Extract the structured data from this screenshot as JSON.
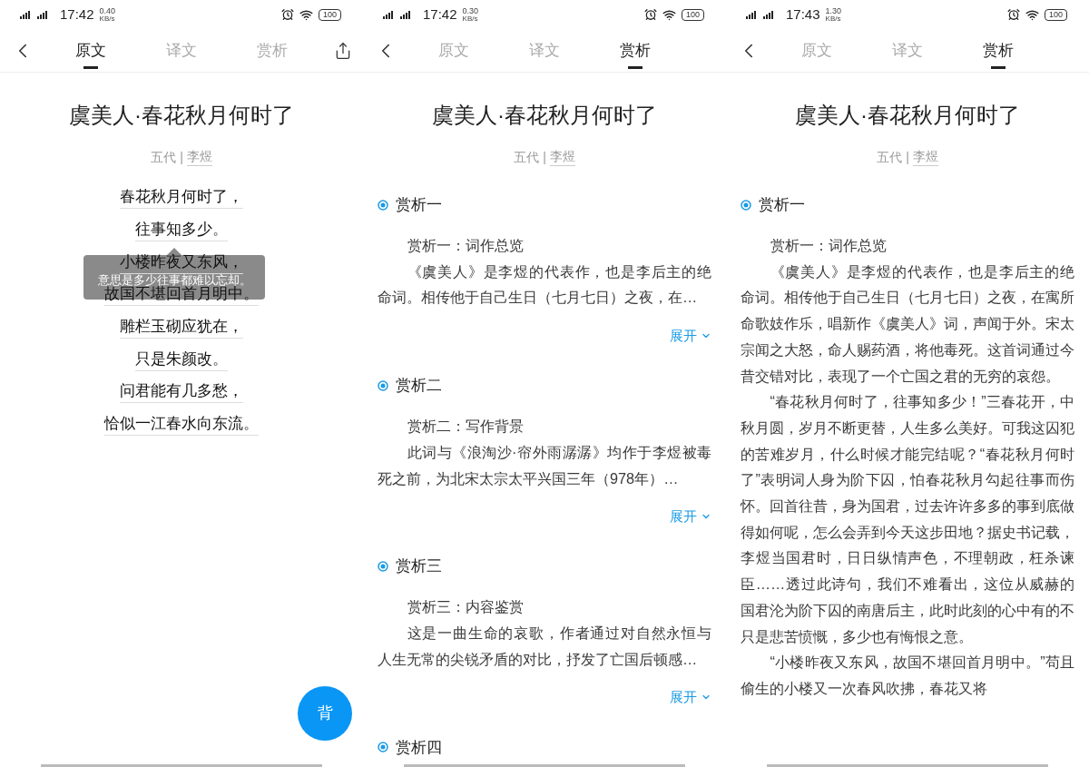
{
  "phones": [
    {
      "status_bar": {
        "time": "17:42",
        "speed": "0.40",
        "speed_unit": "KB/s",
        "battery": "100"
      },
      "tabs": [
        {
          "label": "原文",
          "selected": true
        },
        {
          "label": "译文",
          "selected": false
        },
        {
          "label": "赏析",
          "selected": false
        }
      ],
      "share_button": true,
      "title": "虞美人·春花秋月何时了",
      "dynasty": "五代",
      "separator": "|",
      "author": "李煜",
      "lines": [
        "春花秋月何时了，",
        "往事知多少。",
        "小楼昨夜又东风，",
        "故国不堪回首月明中。",
        "雕栏玉砌应犹在，",
        "只是朱颜改。",
        "问君能有几多愁，",
        "恰似一江春水向东流。"
      ],
      "tooltip": {
        "text": "意思是多少往事都难以忘却。"
      },
      "fab": {
        "label": "背"
      }
    },
    {
      "status_bar": {
        "time": "17:42",
        "speed": "0.30",
        "speed_unit": "KB/s",
        "battery": "100"
      },
      "tabs": [
        {
          "label": "原文",
          "selected": false
        },
        {
          "label": "译文",
          "selected": false
        },
        {
          "label": "赏析",
          "selected": true
        }
      ],
      "title": "虞美人·春花秋月何时了",
      "dynasty": "五代",
      "separator": "|",
      "author": "李煜",
      "sections": [
        {
          "heading": "赏析一",
          "paragraphs": [
            "赏析一：词作总览",
            "《虞美人》是李煜的代表作，也是李后主的绝命词。相传他于自己生日（七月七日）之夜，在…"
          ],
          "expand": "展开"
        },
        {
          "heading": "赏析二",
          "paragraphs": [
            "赏析二：写作背景",
            "此词与《浪淘沙·帘外雨潺潺》均作于李煜被毒死之前，为北宋太宗太平兴国三年（978年）…"
          ],
          "expand": "展开"
        },
        {
          "heading": "赏析三",
          "paragraphs": [
            "赏析三：内容鉴赏",
            "这是一曲生命的哀歌，作者通过对自然永恒与人生无常的尖锐矛盾的对比，抒发了亡国后顿感…"
          ],
          "expand": "展开"
        },
        {
          "heading": "赏析四"
        }
      ]
    },
    {
      "status_bar": {
        "time": "17:43",
        "speed": "1.30",
        "speed_unit": "KB/s",
        "battery": "100"
      },
      "tabs": [
        {
          "label": "原文",
          "selected": false
        },
        {
          "label": "译文",
          "selected": false
        },
        {
          "label": "赏析",
          "selected": true
        }
      ],
      "title": "虞美人·春花秋月何时了",
      "dynasty": "五代",
      "separator": "|",
      "author": "李煜",
      "sections": [
        {
          "heading": "赏析一",
          "paragraphs": [
            "赏析一：词作总览",
            "《虞美人》是李煜的代表作，也是李后主的绝命词。相传他于自己生日（七月七日）之夜，在寓所命歌妓作乐，唱新作《虞美人》词，声闻于外。宋太宗闻之大怒，命人赐药酒，将他毒死。这首词通过今昔交错对比，表现了一个亡国之君的无穷的哀怨。",
            "“春花秋月何时了，往事知多少！”三春花开，中秋月圆，岁月不断更替，人生多么美好。可我这囚犯的苦难岁月，什么时候才能完结呢？“春花秋月何时了”表明词人身为阶下囚，怕春花秋月勾起往事而伤怀。回首往昔，身为国君，过去许许多多的事到底做得如何呢，怎么会弄到今天这步田地？据史书记载，李煜当国君时，日日纵情声色，不理朝政，枉杀谏臣……透过此诗句，我们不难看出，这位从威赫的国君沦为阶下囚的南唐后主，此时此刻的心中有的不只是悲苦愤慨，多少也有悔恨之意。",
            "“小楼昨夜又东风，故国不堪回首月明中。”苟且偷生的小楼又一次春风吹拂，春花又将"
          ]
        }
      ]
    }
  ]
}
